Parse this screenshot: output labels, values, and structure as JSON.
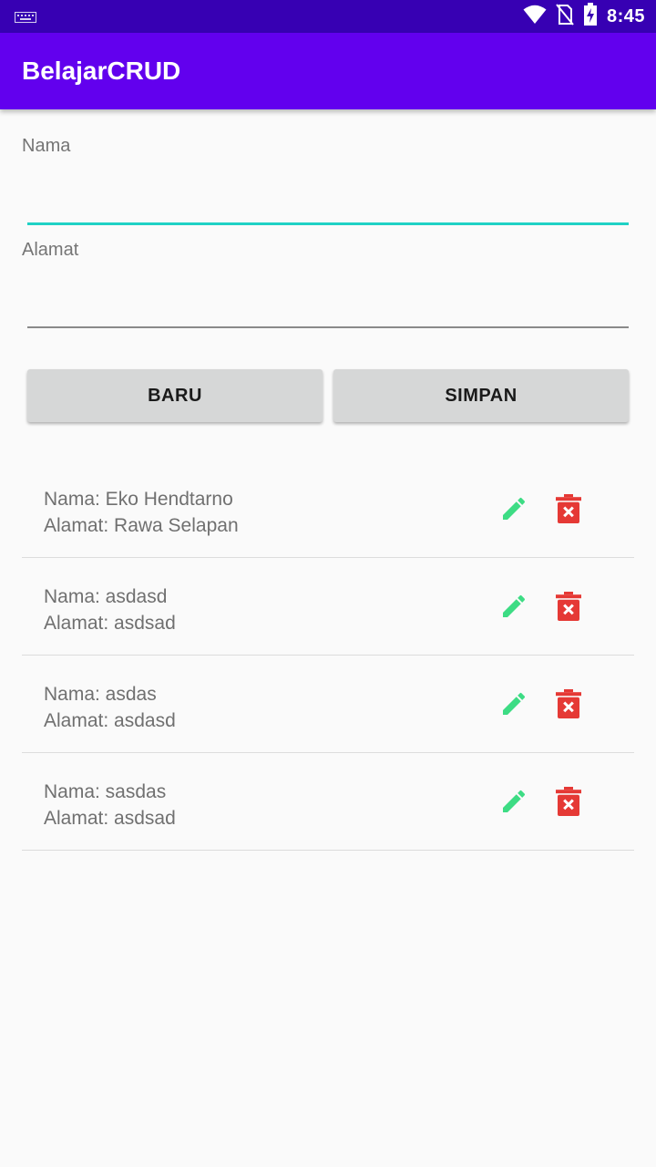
{
  "status_bar": {
    "time": "8:45",
    "icons": [
      "keyboard-icon",
      "wifi-icon",
      "no-sim-icon",
      "battery-charging-icon"
    ]
  },
  "app_bar": {
    "title": "BelajarCRUD"
  },
  "form": {
    "nama_label": "Nama",
    "nama_value": "",
    "alamat_label": "Alamat",
    "alamat_value": "",
    "baru_label": "BARU",
    "simpan_label": "SIMPAN"
  },
  "list": [
    {
      "nama": "Nama: Eko Hendtarno",
      "alamat": "Alamat: Rawa Selapan"
    },
    {
      "nama": "Nama: asdasd",
      "alamat": "Alamat: asdsad"
    },
    {
      "nama": "Nama: asdas",
      "alamat": "Alamat: asdasd"
    },
    {
      "nama": "Nama: sasdas",
      "alamat": "Alamat: asdsad"
    }
  ],
  "colors": {
    "status_bar": "#3700b3",
    "app_bar": "#6200ee",
    "accent": "#1fd1c5",
    "edit_icon": "#3ddc84",
    "delete_icon": "#e53935"
  }
}
